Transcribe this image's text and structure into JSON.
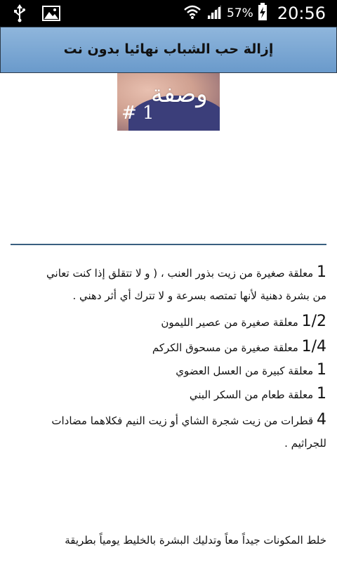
{
  "status_bar": {
    "battery_percent": "57%",
    "time": "20:56",
    "icons": [
      "usb-icon",
      "image-notification-icon",
      "wifi-icon",
      "signal-icon",
      "battery-charging-icon"
    ]
  },
  "header": {
    "title": "إزالة حب الشباب نهائيا بدون نت"
  },
  "recipe_image": {
    "word": "وصفة",
    "number": "# 1"
  },
  "ingredients": [
    {
      "qty": "1",
      "text": "معلقة صغيرة من زيت بذور العنب ، ( و لا تتقلق إذا كنت تعاني"
    },
    {
      "qty": "",
      "text": "من بشرة دهنية لأنها تمتصه بسرعة و لا تترك أي أثر دهني ."
    },
    {
      "qty": "1/2",
      "text": "معلقة صغيرة من عصير الليمون"
    },
    {
      "qty": "1/4",
      "text": "معلقة صغيرة من مسحوق الكركم"
    },
    {
      "qty": "1",
      "text": "معلقة كبيرة من العسل العضوي"
    },
    {
      "qty": "1",
      "text": "معلقة طعام من السكر البني"
    },
    {
      "qty": "4",
      "text": "قطرات من زيت شجرة الشاي أو زيت النيم فكلاهما مضادات"
    },
    {
      "qty": "",
      "text": "للجراثيم ."
    }
  ],
  "instructions": {
    "line1": "خلط المكونات جيداً معاً وتدليك البشرة بالخليط يومياً بطريقة"
  }
}
